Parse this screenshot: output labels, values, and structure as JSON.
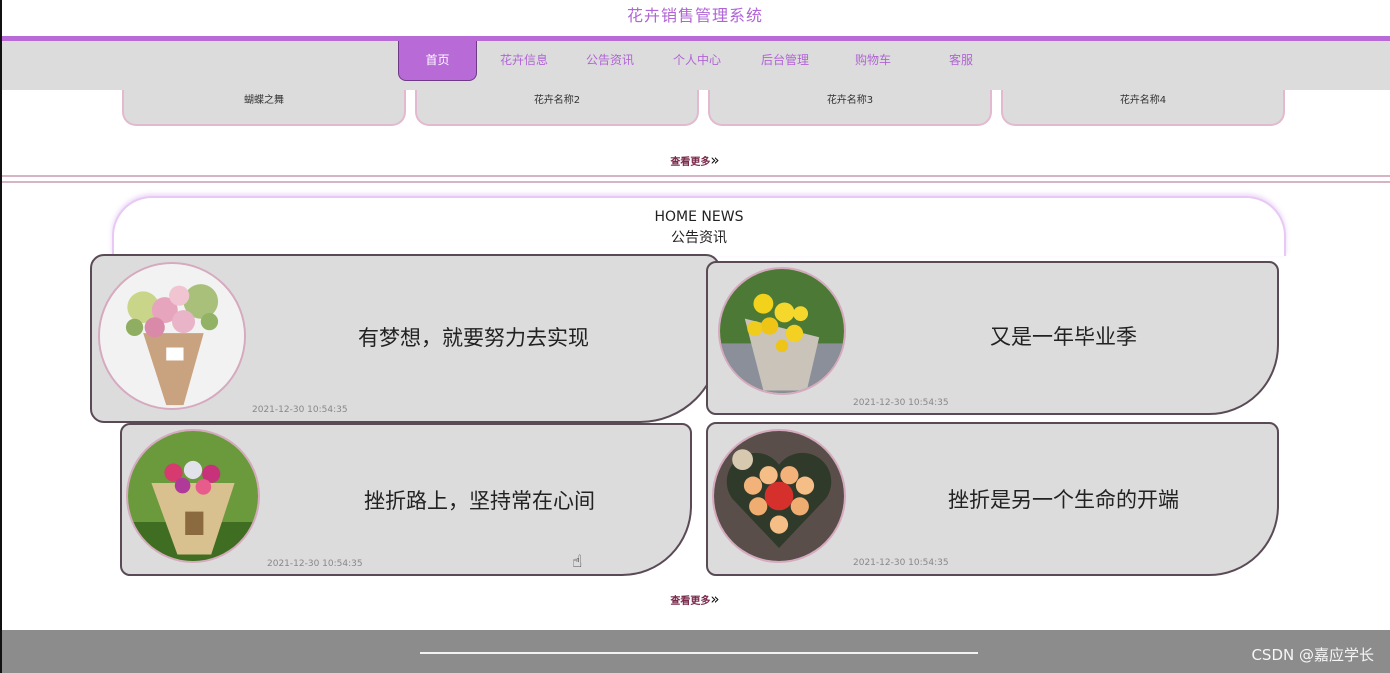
{
  "site": {
    "title": "花卉销售管理系统"
  },
  "nav": {
    "items": [
      {
        "label": "首页",
        "active": true
      },
      {
        "label": "花卉信息"
      },
      {
        "label": "公告资讯"
      },
      {
        "label": "个人中心"
      },
      {
        "label": "后台管理"
      },
      {
        "label": "购物车"
      },
      {
        "label": "客服"
      }
    ]
  },
  "flowers": {
    "items": [
      {
        "name": "蝴蝶之舞"
      },
      {
        "name": "花卉名称2"
      },
      {
        "name": "花卉名称3"
      },
      {
        "name": "花卉名称4"
      }
    ],
    "more": "查看更多"
  },
  "news": {
    "header_en": "HOME NEWS",
    "header_cn": "公告资讯",
    "items": [
      {
        "title": "有梦想，就要努力去实现",
        "date": "2021-12-30 10:54:35",
        "image": "pink-bouquet-photo"
      },
      {
        "title": "又是一年毕业季",
        "date": "2021-12-30 10:54:35",
        "image": "sunflower-bouquet-photo"
      },
      {
        "title": "挫折路上，坚持常在心间",
        "date": "2021-12-30 10:54:35",
        "image": "rose-bouquet-photo"
      },
      {
        "title": "挫折是另一个生命的开端",
        "date": "2021-12-30 10:54:35",
        "image": "heart-rose-box-photo"
      }
    ],
    "more": "查看更多"
  },
  "footer": {
    "watermark": "CSDN @嘉应学长"
  },
  "colors": {
    "accent": "#b86bd6",
    "nav_bg": "#dcdcdc",
    "footer_bg": "#8c8c8c"
  }
}
